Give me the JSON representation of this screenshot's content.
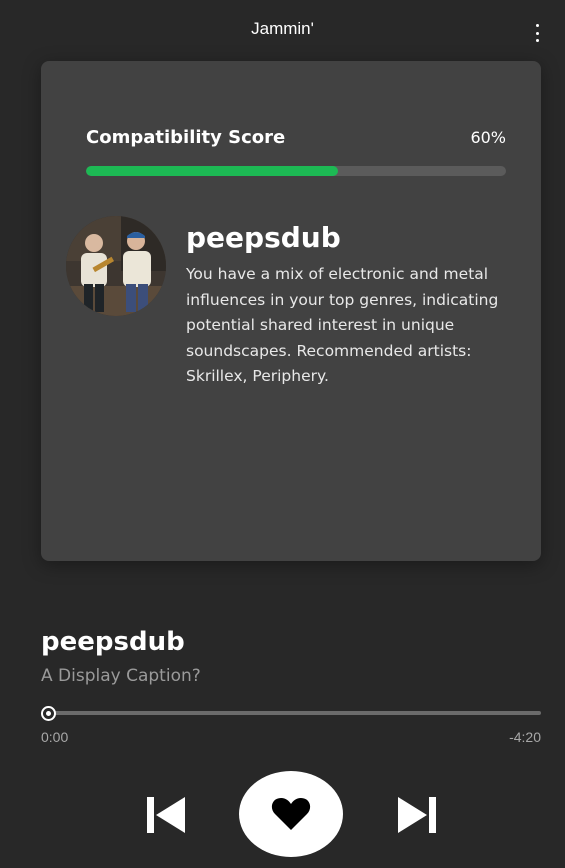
{
  "app": {
    "title": "Jammin'",
    "menu_icon": "more-vertical-icon"
  },
  "card": {
    "score_label": "Compatibility Score",
    "score_display": "60%",
    "score_fraction": 0.6,
    "accent_color": "#1db954",
    "avatar_icon": "user-photo",
    "name": "peepsdub",
    "description": "You have a mix of electronic and metal influences in your top genres, indicating potential shared interest in unique soundscapes. Recommended artists: Skrillex, Periphery."
  },
  "player": {
    "title": "peepsdub",
    "caption": "A Display Caption?",
    "progress_fraction": 0,
    "time_elapsed": "0:00",
    "time_remaining": "-4:20",
    "prev_icon": "skip-previous-icon",
    "like_icon": "heart-icon",
    "next_icon": "skip-next-icon"
  }
}
